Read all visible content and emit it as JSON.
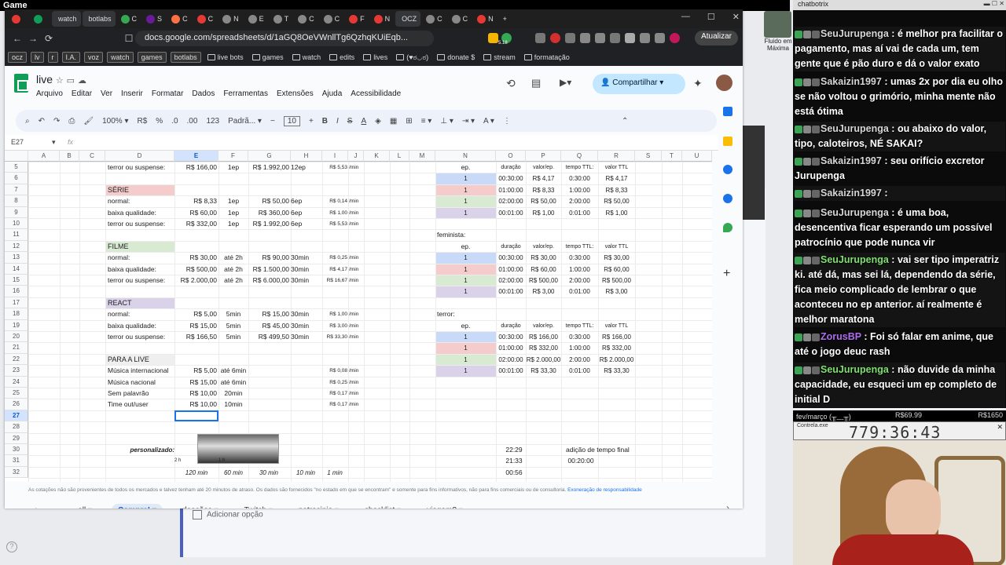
{
  "desktop": {
    "title": "Game"
  },
  "browser": {
    "tabs": [
      {
        "label": "",
        "color": "#e53935"
      },
      {
        "label": "",
        "color": "#0f9d58"
      },
      {
        "label": "watch",
        "color": "#c0392b"
      },
      {
        "label": "botlabs",
        "color": "#1565c0"
      },
      {
        "label": "C",
        "color": "#34a853"
      },
      {
        "label": "S",
        "color": "#6a1b9a"
      },
      {
        "label": "C",
        "color": "#ff7043"
      },
      {
        "label": "C",
        "color": "#e53935"
      },
      {
        "label": "N",
        "color": "#888888"
      },
      {
        "label": "E",
        "color": "#888888"
      },
      {
        "label": "T",
        "color": "#888888"
      },
      {
        "label": "C",
        "color": "#888888"
      },
      {
        "label": "C",
        "color": "#888888"
      },
      {
        "label": "F",
        "color": "#e53935"
      },
      {
        "label": "N",
        "color": "#e53935"
      },
      {
        "label": "OCZ",
        "color": "#333333"
      },
      {
        "label": "C",
        "color": "#888888"
      },
      {
        "label": "C",
        "color": "#888888"
      },
      {
        "label": "N",
        "color": "#e53935"
      }
    ],
    "url": "docs.google.com/spreadsheets/d/1aGQ8OeVWnllTg6QzhqKUiEqb...",
    "update_label": "Atualizar",
    "bookmarks": [
      "ocz",
      "lv",
      "r",
      "I.A.",
      "voz",
      "watch",
      "games",
      "botlabs",
      "live bots",
      "games",
      "watch",
      "edits",
      "lives",
      "(♥ಠ◡ಠ)",
      "donate $",
      "stream",
      "formatação"
    ],
    "profile_badge": "5.18"
  },
  "sheets": {
    "doc_title": "live",
    "menu": [
      "Arquivo",
      "Editar",
      "Ver",
      "Inserir",
      "Formatar",
      "Dados",
      "Ferramentas",
      "Extensões",
      "Ajuda",
      "Acessibilidade"
    ],
    "share_label": "Compartilhar",
    "zoom": "100%",
    "font": "Padrã...",
    "font_size": "10",
    "currency": "R$",
    "percent": "%",
    "num_fmt": "123",
    "cell_ref": "E27",
    "fx": "fx",
    "columns": [
      "A",
      "B",
      "C",
      "D",
      "E",
      "F",
      "G",
      "H",
      "I",
      "J",
      "K",
      "L",
      "M",
      "N",
      "O",
      "P",
      "Q",
      "R",
      "S",
      "T",
      "U"
    ],
    "rows": [
      "5",
      "6",
      "7",
      "8",
      "9",
      "10",
      "11",
      "12",
      "13",
      "14",
      "15",
      "16",
      "17",
      "18",
      "19",
      "20",
      "21",
      "22",
      "23",
      "24",
      "25",
      "26",
      "27",
      "28",
      "29",
      "30",
      "31",
      "32"
    ],
    "left_table": [
      [
        "terror ou suspense:",
        "R$ 166,00",
        "1ep",
        "R$ 1.992,00",
        "12ep",
        "R$ 5,53",
        "/min"
      ],
      [
        "",
        "",
        "",
        "",
        "",
        "",
        ""
      ],
      [
        "SÉRIE",
        "",
        "",
        "",
        "",
        "",
        ""
      ],
      [
        "normal:",
        "R$ 8,33",
        "1ep",
        "R$ 50,00",
        "6ep",
        "R$ 0,14",
        "/min"
      ],
      [
        "baixa qualidade:",
        "R$ 60,00",
        "1ep",
        "R$ 360,00",
        "6ep",
        "R$ 1,00",
        "/min"
      ],
      [
        "terror ou suspense:",
        "R$ 332,00",
        "1ep",
        "R$ 1.992,00",
        "6ep",
        "R$ 5,53",
        "/min"
      ],
      [
        "",
        "",
        "",
        "",
        "",
        "",
        ""
      ],
      [
        "FILME",
        "",
        "",
        "",
        "",
        "",
        ""
      ],
      [
        "normal:",
        "R$ 30,00",
        "até 2h",
        "R$ 90,00",
        "30min",
        "R$ 0,25",
        "/min"
      ],
      [
        "baixa qualidade:",
        "R$ 500,00",
        "até 2h",
        "R$ 1.500,00",
        "30min",
        "R$ 4,17",
        "/min"
      ],
      [
        "terror ou suspense:",
        "R$ 2.000,00",
        "até 2h",
        "R$ 6.000,00",
        "30min",
        "R$ 16,67",
        "/min"
      ],
      [
        "",
        "",
        "",
        "",
        "",
        "",
        ""
      ],
      [
        "REACT",
        "",
        "",
        "",
        "",
        "",
        ""
      ],
      [
        "normal:",
        "R$ 5,00",
        "5min",
        "R$ 15,00",
        "30min",
        "R$ 1,00",
        "/min"
      ],
      [
        "baixa qualidade:",
        "R$ 15,00",
        "5min",
        "R$ 45,00",
        "30min",
        "R$ 3,00",
        "/min"
      ],
      [
        "terror ou suspense:",
        "R$ 166,50",
        "5min",
        "R$ 499,50",
        "30min",
        "R$ 33,30",
        "/min"
      ],
      [
        "",
        "",
        "",
        "",
        "",
        "",
        ""
      ],
      [
        "PARA A LIVE",
        "",
        "",
        "",
        "",
        "",
        ""
      ],
      [
        "Música internacional",
        "R$ 5,00",
        "até 6min",
        "",
        "",
        "R$ 0,08",
        "/min"
      ],
      [
        "Música nacional",
        "R$ 15,00",
        "até 6min",
        "",
        "",
        "R$ 0,25",
        "/min"
      ],
      [
        "Sem palavrão",
        "R$ 10,00",
        "20min",
        "",
        "",
        "R$ 0,17",
        "/min"
      ],
      [
        "Time out/user",
        "R$ 10,00",
        "10min",
        "",
        "",
        "R$ 0,17",
        "/min"
      ]
    ],
    "right_block1": {
      "header": [
        "ep.",
        "duração",
        "valor/ep.",
        "tempo TTL:",
        "valor TTL"
      ],
      "rows": [
        [
          "1",
          "00:30:00",
          "R$ 4,17",
          "0:30:00",
          "R$ 4,17"
        ],
        [
          "1",
          "01:00:00",
          "R$ 8,33",
          "1:00:00",
          "R$ 8,33"
        ],
        [
          "1",
          "02:00:00",
          "R$ 50,00",
          "2:00:00",
          "R$ 50,00"
        ],
        [
          "1",
          "00:01:00",
          "R$ 1,00",
          "0:01:00",
          "R$ 1,00"
        ]
      ]
    },
    "right_block2": {
      "title": "feminista:",
      "header": [
        "ep.",
        "duração",
        "valor/ep.",
        "tempo TTL:",
        "valor TTL"
      ],
      "rows": [
        [
          "1",
          "00:30:00",
          "R$ 30,00",
          "0:30:00",
          "R$ 30,00"
        ],
        [
          "1",
          "01:00:00",
          "R$ 60,00",
          "1:00:00",
          "R$ 60,00"
        ],
        [
          "1",
          "02:00:00",
          "R$ 500,00",
          "2:00:00",
          "R$ 500,00"
        ],
        [
          "1",
          "00:01:00",
          "R$ 3,00",
          "0:01:00",
          "R$ 3,00"
        ]
      ]
    },
    "right_block3": {
      "title": "terror:",
      "header": [
        "ep.",
        "duração",
        "valor/ep.",
        "tempo TTL:",
        "valor TTL"
      ],
      "rows": [
        [
          "1",
          "00:30:00",
          "R$ 166,00",
          "0:30:00",
          "R$ 166,00"
        ],
        [
          "1",
          "01:00:00",
          "R$ 332,00",
          "1:00:00",
          "R$ 332,00"
        ],
        [
          "1",
          "02:00:00",
          "R$ 2.000,00",
          "2:00:00",
          "R$ 2.000,00"
        ],
        [
          "1",
          "00:01:00",
          "R$ 33,30",
          "0:01:00",
          "R$ 33,30"
        ]
      ]
    },
    "personalizado": {
      "label": "personalizado:",
      "times": [
        "22:29",
        "21:33",
        "00:56"
      ],
      "final_label": "adição de tempo final",
      "final_value": "00:20:00",
      "scale": [
        "2 h",
        "1 h",
        "120 min",
        "60 min",
        "30 min",
        "10 min",
        "1 min"
      ]
    },
    "footnote": "As cotações não são provenientes de todos os mercados e talvez tenham até 20 minutos de atraso. Os dados são fornecidos \"no estado em que se encontram\" e somente para fins informativos, não para fins comerciais ou de consultoria.",
    "footnote_link": "Exoneração de responsabilidade",
    "sheet_tabs": [
      "all",
      "Compre!",
      "doações",
      "Twitch",
      "patrocinio",
      "checklist",
      "viagem?"
    ],
    "active_tab": "Compre!"
  },
  "background_form": {
    "option": "Adicionar opção"
  },
  "chat": {
    "header": "chatbotrix",
    "messages": [
      {
        "user": "SeuJurupenga",
        "text": "é melhor pra facilitar o pagamento, mas aí vai de cada um, tem gente que é pão duro e dá o valor exato",
        "cls": "name"
      },
      {
        "user": "Sakaizin1997",
        "text": "umas 2x por dia eu olho se não voltou o grimório, minha mente não está ótima",
        "cls": "name"
      },
      {
        "user": "SeuJurupenga",
        "text": "ou abaixo do valor, tipo, caloteiros, NÉ SAKAI?",
        "cls": "name"
      },
      {
        "user": "Sakaizin1997",
        "text": "seu orifício excretor Jurupenga",
        "cls": "name"
      },
      {
        "user": "Sakaizin1997",
        "text": "",
        "cls": "name"
      },
      {
        "user": "SeuJurupenga",
        "text": "é uma boa, desencentiva ficar esperando um possível patrocínio que pode nunca vir",
        "cls": "name"
      },
      {
        "user": "SeuJurupenga",
        "text": "vai ser tipo imperatriz ki. até dá, mas sei lá, dependendo da série, fica meio complicado de lembrar o que aconteceu no ep anterior. aí realmente é melhor maratona",
        "cls": "name g"
      },
      {
        "user": "ZorusBP",
        "text": "Foi só falar em anime, que até o jogo deuc rash",
        "cls": "name p"
      },
      {
        "user": "SeuJurupenga",
        "text": "não duvide da minha capacidade, eu esqueci um ep completo de initial D",
        "cls": "name g"
      }
    ]
  },
  "overlay": {
    "goal_label": "fev/março (╥﹏╥)",
    "goal_current": "R$69.99",
    "goal_total": "R$1650",
    "timer_label": "Contrela.exe",
    "timer": "779:36:43",
    "desktop_badge": "Fluido em Máxima"
  }
}
